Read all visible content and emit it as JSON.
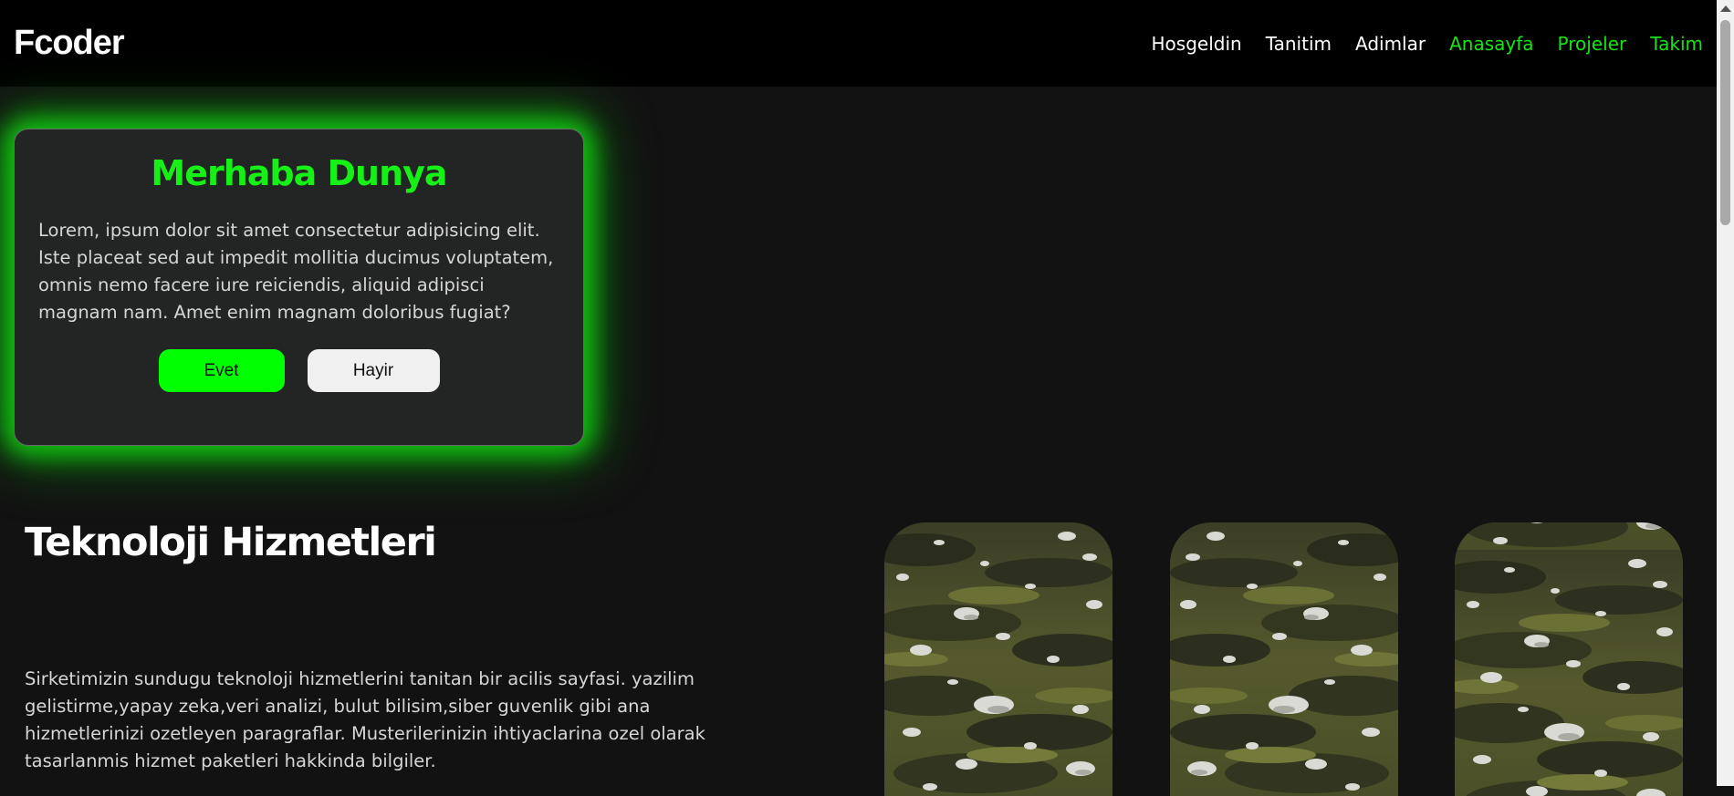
{
  "navbar": {
    "brand": "Fcoder",
    "links": [
      {
        "label": "Hosgeldin",
        "accent": false
      },
      {
        "label": "Tanitim",
        "accent": false
      },
      {
        "label": "Adimlar",
        "accent": false
      },
      {
        "label": "Anasayfa",
        "accent": true
      },
      {
        "label": "Projeler",
        "accent": true
      },
      {
        "label": "Takim",
        "accent": true
      }
    ]
  },
  "card": {
    "title": "Merhaba Dunya",
    "text": "Lorem, ipsum dolor sit amet consectetur adipisicing elit. Iste placeat sed aut impedit mollitia ducimus voluptatem, omnis nemo facere iure reiciendis, aliquid adipisci magnam nam. Amet enim magnam doloribus fugiat?",
    "yes_label": "Evet",
    "no_label": "Hayir"
  },
  "services": {
    "title": "Teknoloji Hizmetleri",
    "text": "Sirketimizin sundugu teknoloji hizmetlerini tanitan bir acilis sayfasi. yazilim gelistirme,yapay zeka,veri analizi, bulut bilisim,siber guvenlik gibi ana hizmetlerinizi ozetleyen paragraflar. Musterilerinizin ihtiyaclarina ozel olarak tasarlanmis hizmet paketleri hakkinda bilgiler."
  },
  "colors": {
    "accent": "#17e317",
    "background": "#121212",
    "navbar": "#000000",
    "card": "#232424"
  },
  "images": [
    {
      "name": "grass-field-image"
    },
    {
      "name": "grass-field-image"
    },
    {
      "name": "grass-field-image"
    }
  ]
}
